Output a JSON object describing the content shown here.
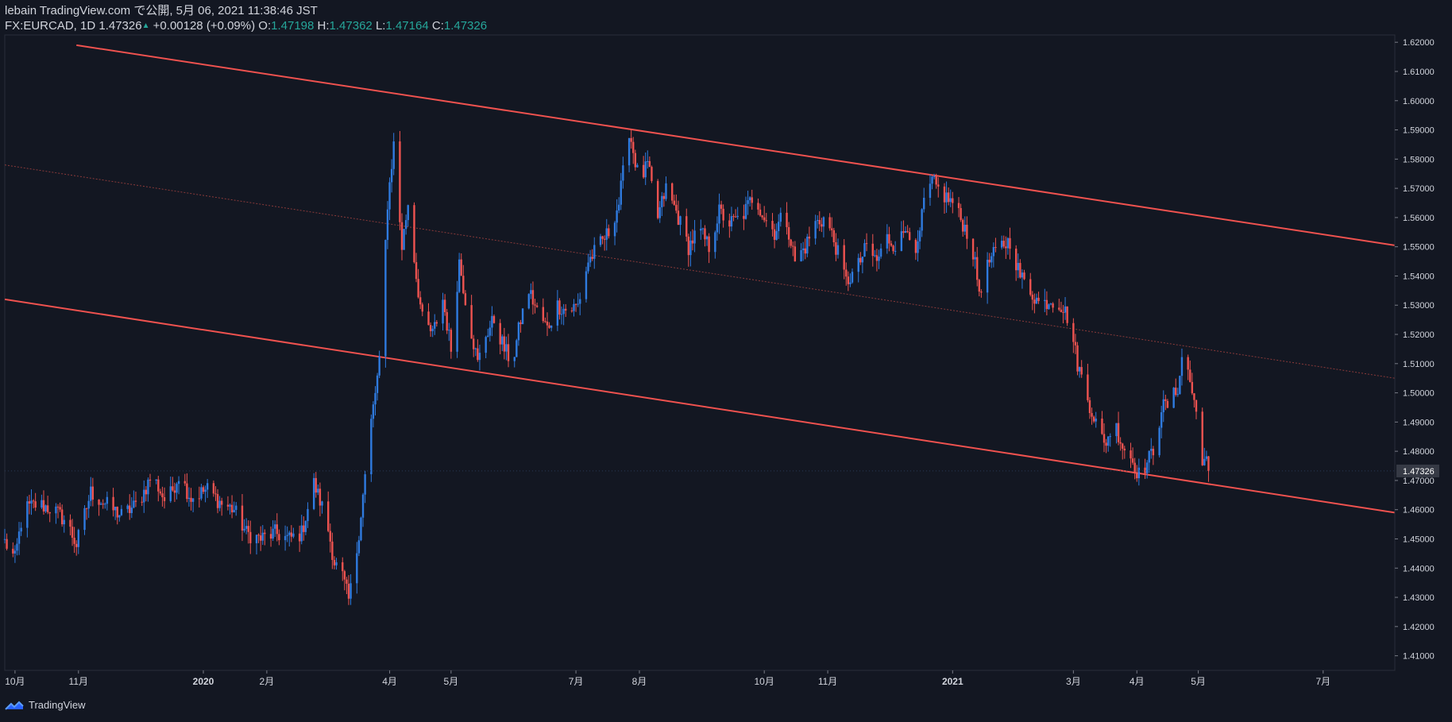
{
  "header": {
    "publish_line": "lebain TradingView.com で公開, 5月 06, 2021 11:38:46 JST",
    "symbol": "FX:EURCAD, 1D",
    "last": "1.47326",
    "change": "+0.00128 (+0.09%)",
    "o_label": "O:",
    "o_value": "1.47198",
    "h_label": "H:",
    "h_value": "1.47362",
    "l_label": "L:",
    "l_value": "1.47164",
    "c_label": "C:",
    "c_value": "1.47326"
  },
  "footer": {
    "brand": "TradingView"
  },
  "colors": {
    "background": "#131722",
    "up": "#2f7be0",
    "down": "#ef5350",
    "channel": "#f0524f",
    "axis_text": "#d1d4dc",
    "last_price_bg": "#363a45"
  },
  "chart_data": {
    "type": "candlestick",
    "symbol": "FX:EURCAD",
    "timeframe": "1D",
    "ylim": [
      1.405,
      1.6225
    ],
    "y_ticks": [
      "1.41000",
      "1.42000",
      "1.43000",
      "1.44000",
      "1.45000",
      "1.46000",
      "1.47000",
      "1.48000",
      "1.49000",
      "1.50000",
      "1.51000",
      "1.52000",
      "1.53000",
      "1.54000",
      "1.55000",
      "1.56000",
      "1.57000",
      "1.58000",
      "1.59000",
      "1.60000",
      "1.61000",
      "1.62000"
    ],
    "x_ticks": [
      {
        "label": "10月",
        "date": "2019-10-01"
      },
      {
        "label": "11月",
        "date": "2019-11-01"
      },
      {
        "label": "2020",
        "date": "2020-01-01"
      },
      {
        "label": "2月",
        "date": "2020-02-01"
      },
      {
        "label": "4月",
        "date": "2020-04-01"
      },
      {
        "label": "5月",
        "date": "2020-05-01"
      },
      {
        "label": "7月",
        "date": "2020-07-01"
      },
      {
        "label": "8月",
        "date": "2020-08-01"
      },
      {
        "label": "10月",
        "date": "2020-10-01"
      },
      {
        "label": "11月",
        "date": "2020-11-01"
      },
      {
        "label": "2021",
        "date": "2021-01-01"
      },
      {
        "label": "3月",
        "date": "2021-03-01"
      },
      {
        "label": "4月",
        "date": "2021-04-01"
      },
      {
        "label": "5月",
        "date": "2021-05-01"
      },
      {
        "label": "7月",
        "date": "2021-07-01"
      }
    ],
    "last_price": "1.47326",
    "path": [
      [
        "2019-09-26",
        1.449
      ],
      [
        "2019-10-01",
        1.443
      ],
      [
        "2019-10-05",
        1.46
      ],
      [
        "2019-10-12",
        1.462
      ],
      [
        "2019-10-20",
        1.46
      ],
      [
        "2019-10-26",
        1.456
      ],
      [
        "2019-10-31",
        1.448
      ],
      [
        "2019-11-07",
        1.466
      ],
      [
        "2019-11-14",
        1.462
      ],
      [
        "2019-11-22",
        1.458
      ],
      [
        "2019-11-30",
        1.462
      ],
      [
        "2019-12-07",
        1.472
      ],
      [
        "2019-12-14",
        1.462
      ],
      [
        "2019-12-20",
        1.472
      ],
      [
        "2019-12-26",
        1.464
      ],
      [
        "2020-01-03",
        1.467
      ],
      [
        "2020-01-10",
        1.462
      ],
      [
        "2020-01-16",
        1.46
      ],
      [
        "2020-01-22",
        1.452
      ],
      [
        "2020-01-29",
        1.45
      ],
      [
        "2020-02-05",
        1.452
      ],
      [
        "2020-02-12",
        1.45
      ],
      [
        "2020-02-18",
        1.452
      ],
      [
        "2020-02-24",
        1.469
      ],
      [
        "2020-03-01",
        1.457
      ],
      [
        "2020-03-05",
        1.442
      ],
      [
        "2020-03-09",
        1.437
      ],
      [
        "2020-03-12",
        1.429
      ],
      [
        "2020-03-15",
        1.44
      ],
      [
        "2020-03-19",
        1.465
      ],
      [
        "2020-03-23",
        1.49
      ],
      [
        "2020-03-27",
        1.51
      ],
      [
        "2020-03-31",
        1.565
      ],
      [
        "2020-04-03",
        1.585
      ],
      [
        "2020-04-07",
        1.55
      ],
      [
        "2020-04-10",
        1.565
      ],
      [
        "2020-04-14",
        1.54
      ],
      [
        "2020-04-17",
        1.525
      ],
      [
        "2020-04-22",
        1.52
      ],
      [
        "2020-04-27",
        1.532
      ],
      [
        "2020-05-01",
        1.515
      ],
      [
        "2020-05-05",
        1.545
      ],
      [
        "2020-05-09",
        1.528
      ],
      [
        "2020-05-14",
        1.51
      ],
      [
        "2020-05-18",
        1.52
      ],
      [
        "2020-05-22",
        1.525
      ],
      [
        "2020-05-27",
        1.515
      ],
      [
        "2020-05-31",
        1.51
      ],
      [
        "2020-06-04",
        1.525
      ],
      [
        "2020-06-08",
        1.535
      ],
      [
        "2020-06-12",
        1.528
      ],
      [
        "2020-06-17",
        1.522
      ],
      [
        "2020-06-22",
        1.53
      ],
      [
        "2020-06-27",
        1.528
      ],
      [
        "2020-07-02",
        1.53
      ],
      [
        "2020-07-07",
        1.545
      ],
      [
        "2020-07-12",
        1.55
      ],
      [
        "2020-07-17",
        1.555
      ],
      [
        "2020-07-22",
        1.565
      ],
      [
        "2020-07-27",
        1.59
      ],
      [
        "2020-08-01",
        1.572
      ],
      [
        "2020-08-05",
        1.578
      ],
      [
        "2020-08-10",
        1.56
      ],
      [
        "2020-08-14",
        1.57
      ],
      [
        "2020-08-19",
        1.562
      ],
      [
        "2020-08-25",
        1.55
      ],
      [
        "2020-08-30",
        1.556
      ],
      [
        "2020-09-04",
        1.55
      ],
      [
        "2020-09-09",
        1.562
      ],
      [
        "2020-09-14",
        1.558
      ],
      [
        "2020-09-20",
        1.56
      ],
      [
        "2020-09-26",
        1.568
      ],
      [
        "2020-10-01",
        1.56
      ],
      [
        "2020-10-06",
        1.555
      ],
      [
        "2020-10-11",
        1.562
      ],
      [
        "2020-10-16",
        1.545
      ],
      [
        "2020-10-21",
        1.55
      ],
      [
        "2020-10-26",
        1.558
      ],
      [
        "2020-10-31",
        1.56
      ],
      [
        "2020-11-05",
        1.55
      ],
      [
        "2020-11-10",
        1.538
      ],
      [
        "2020-11-15",
        1.542
      ],
      [
        "2020-11-20",
        1.55
      ],
      [
        "2020-11-25",
        1.545
      ],
      [
        "2020-11-30",
        1.553
      ],
      [
        "2020-12-05",
        1.55
      ],
      [
        "2020-12-10",
        1.558
      ],
      [
        "2020-12-14",
        1.545
      ],
      [
        "2020-12-18",
        1.565
      ],
      [
        "2020-12-22",
        1.572
      ],
      [
        "2020-12-27",
        1.568
      ],
      [
        "2021-01-01",
        1.565
      ],
      [
        "2021-01-06",
        1.558
      ],
      [
        "2021-01-10",
        1.552
      ],
      [
        "2021-01-14",
        1.535
      ],
      [
        "2021-01-19",
        1.545
      ],
      [
        "2021-01-24",
        1.55
      ],
      [
        "2021-01-29",
        1.552
      ],
      [
        "2021-02-03",
        1.54
      ],
      [
        "2021-02-08",
        1.535
      ],
      [
        "2021-02-13",
        1.53
      ],
      [
        "2021-02-18",
        1.532
      ],
      [
        "2021-02-23",
        1.53
      ],
      [
        "2021-02-27",
        1.525
      ],
      [
        "2021-03-03",
        1.51
      ],
      [
        "2021-03-08",
        1.498
      ],
      [
        "2021-03-12",
        1.49
      ],
      [
        "2021-03-16",
        1.482
      ],
      [
        "2021-03-21",
        1.49
      ],
      [
        "2021-03-25",
        1.482
      ],
      [
        "2021-03-29",
        1.478
      ],
      [
        "2021-04-02",
        1.472
      ],
      [
        "2021-04-06",
        1.476
      ],
      [
        "2021-04-10",
        1.482
      ],
      [
        "2021-04-13",
        1.495
      ],
      [
        "2021-04-17",
        1.496
      ],
      [
        "2021-04-21",
        1.502
      ],
      [
        "2021-04-24",
        1.516
      ],
      [
        "2021-04-28",
        1.5
      ],
      [
        "2021-05-01",
        1.49
      ],
      [
        "2021-05-03",
        1.478
      ],
      [
        "2021-05-05",
        1.476
      ],
      [
        "2021-05-06",
        1.4733
      ]
    ],
    "channel": {
      "upper": [
        [
          "2019-10-31",
          1.619
        ],
        [
          "2021-08-05",
          1.5505
        ]
      ],
      "lower": [
        [
          "2019-09-26",
          1.532
        ],
        [
          "2021-08-05",
          1.459
        ]
      ],
      "middle": [
        [
          "2019-09-26",
          1.578
        ],
        [
          "2021-08-05",
          1.505
        ]
      ]
    }
  }
}
